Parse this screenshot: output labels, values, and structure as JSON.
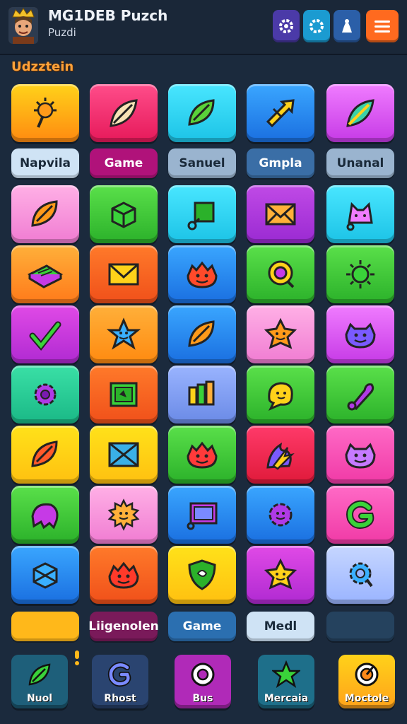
{
  "header": {
    "title": "MG1DEB Puzch",
    "subtitle": "Puzdi"
  },
  "section_label": "Udzztein",
  "pills_top": [
    "Napvila",
    "Game",
    "Sanuel",
    "Gmpla",
    "Unanal"
  ],
  "pills_bottom": [
    "",
    "Liigenolen",
    "Game",
    "Medl",
    ""
  ],
  "nav": [
    "Nuol",
    "Rhost",
    "Bus",
    "Mercaia",
    "Moctole"
  ],
  "colors": {
    "background": "#1b2a3d",
    "accent_orange": "#ff6a1f",
    "section_label": "#ffa23a"
  },
  "icons": {
    "header_buttons": [
      "gear-icon",
      "gear-icon",
      "figure-icon",
      "menu-icon"
    ],
    "tiles": [
      [
        "sun-icon",
        "leaf-icon",
        "leaf-icon",
        "arrow-icon",
        "leaf-icon"
      ],
      [
        "leaf-icon",
        "cube-icon",
        "square-icon",
        "envelope-icon",
        "cat-icon"
      ],
      [
        "book-icon",
        "envelope-icon",
        "monster-icon",
        "ring-icon",
        "sun-icon"
      ],
      [
        "check-icon",
        "star-icon",
        "leaf-icon",
        "star-icon",
        "monster-icon"
      ],
      [
        "gear-icon",
        "panel-icon",
        "books-icon",
        "blob-icon",
        "bone-icon"
      ],
      [
        "leaf-icon",
        "envelope-icon",
        "monster-icon",
        "fire-icon",
        "monster-icon"
      ],
      [
        "ghost-icon",
        "sun-icon",
        "panel-icon",
        "gear-icon",
        "spiral-icon"
      ],
      [
        "cube-icon",
        "monster-icon",
        "shield-icon",
        "star-icon",
        "gear-icon"
      ]
    ],
    "nav": [
      "leaf-icon",
      "spiral-icon",
      "ring-icon",
      "star-icon",
      "target-icon"
    ]
  }
}
